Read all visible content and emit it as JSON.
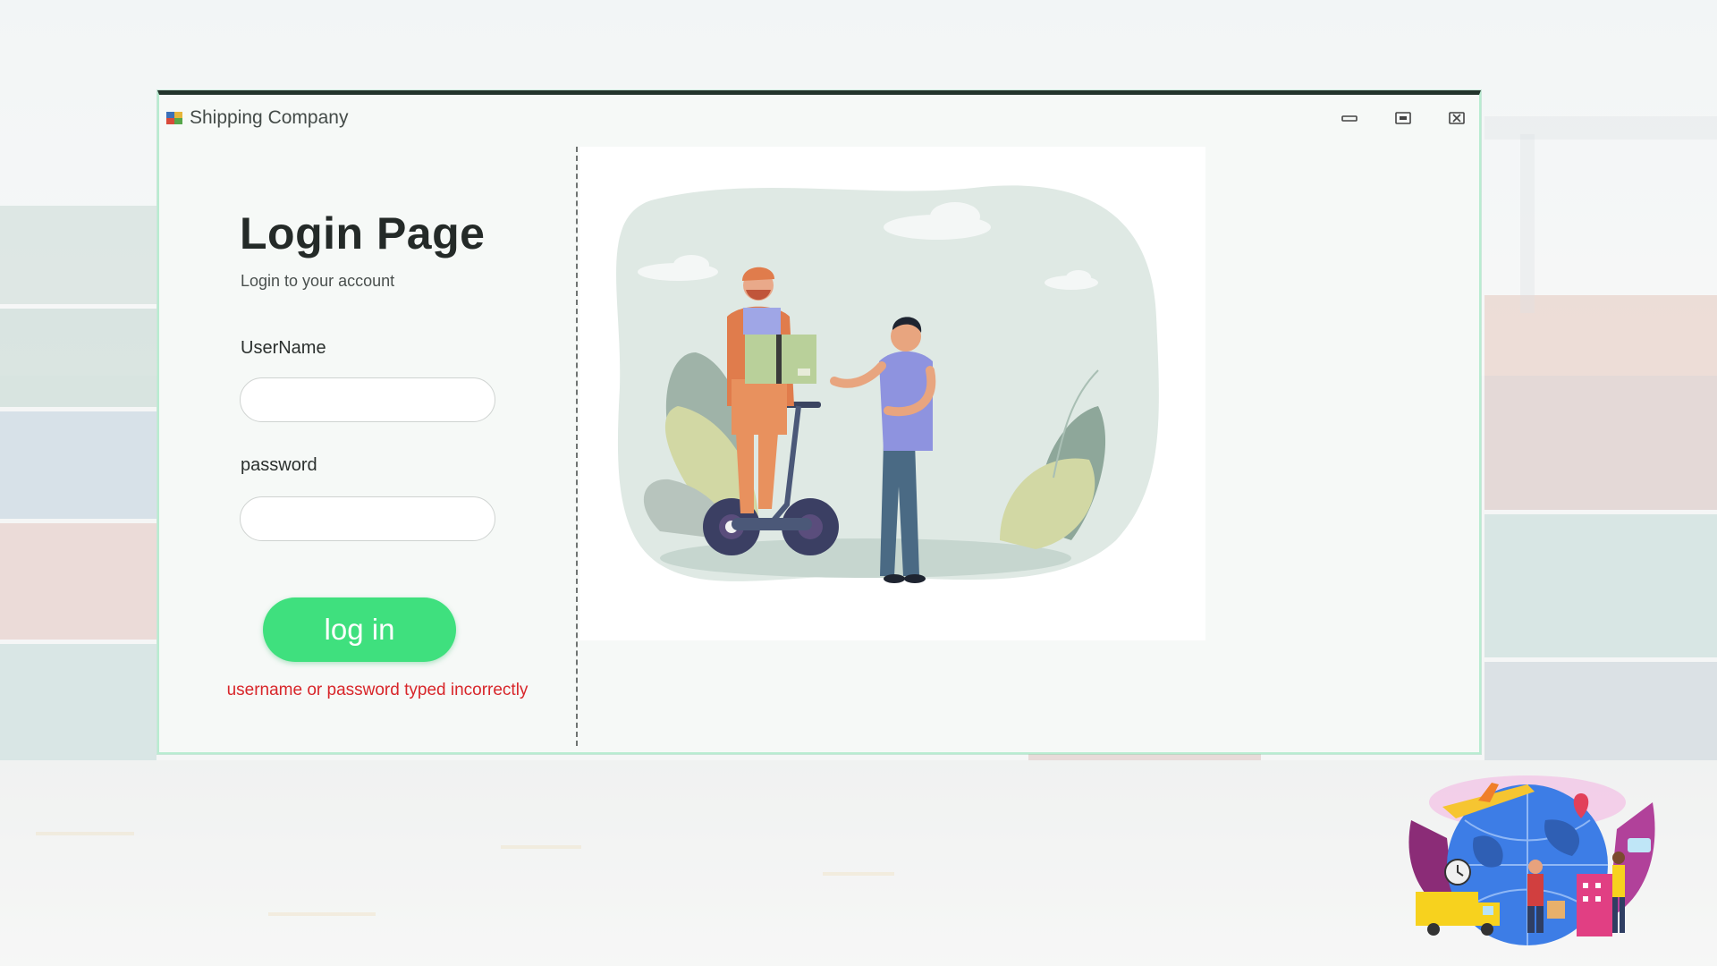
{
  "window": {
    "title": "Shipping Company",
    "icon": "app-icon",
    "controls": [
      "minimize-icon",
      "maximize-icon",
      "close-icon"
    ]
  },
  "login": {
    "heading": "Login Page",
    "subheading": "Login to your account",
    "username_label": "UserName",
    "username_value": "",
    "password_label": "password",
    "password_value": "",
    "button_label": "log in",
    "error_message": "username or password typed incorrectly"
  },
  "colors": {
    "accent_green": "#3fe07e",
    "error_red": "#d8262a",
    "title_bar_border": "#23342c"
  },
  "illustration": {
    "subject": "courier on self-balancing scooter delivering a parcel to a customer"
  }
}
